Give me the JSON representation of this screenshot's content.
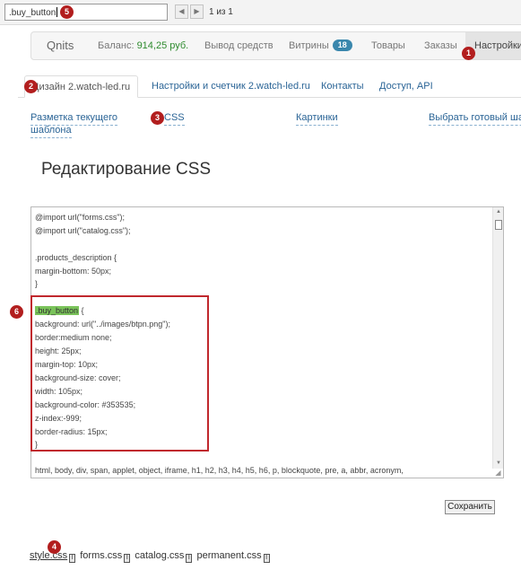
{
  "find_bar": {
    "query": ".buy_button",
    "prev_arrow": "◀",
    "next_arrow": "▶",
    "match_count": "1 из 1"
  },
  "markers": [
    "1",
    "2",
    "3",
    "4",
    "5",
    "6"
  ],
  "navbar": {
    "brand": "Qnits",
    "balance_label": "Баланс: ",
    "balance_value": "914,25 руб.",
    "withdraw": "Вывод средств",
    "showcases": "Витрины",
    "showcases_badge": "18",
    "goods": "Товары",
    "orders": "Заказы",
    "settings": "Настройки"
  },
  "tabs": [
    {
      "label": "Дизайн 2.watch-led.ru"
    },
    {
      "label": "Настройки и счетчик 2.watch-led.ru"
    },
    {
      "label": "Контакты"
    },
    {
      "label": "Доступ, API"
    }
  ],
  "subnav": {
    "markup_line1": "Разметка текущего",
    "markup_line2": "шаблона",
    "css": "CSS",
    "images": "Картинки",
    "choose_template": "Выбрать готовый шаблон"
  },
  "page_title": "Редактирование CSS",
  "editor": {
    "lines": [
      "@import url(\"forms.css\");",
      "@import url(\"catalog.css\");",
      "",
      ".products_description {",
      "    margin-bottom: 50px;",
      "}",
      "",
      ".buy_button {",
      "background: url(\"../images/btpn.png\");",
      "border:medium none;",
      "height: 25px;",
      "margin-top: 10px;",
      "background-size: cover;",
      "width: 105px;",
      "background-color: #353535;",
      "z-index:-999;",
      "border-radius: 15px;",
      "}",
      "",
      "html, body, div, span, applet, object, iframe, h1, h2, h3, h4, h5, h6, p, blockquote, pre, a, abbr, acronym,"
    ],
    "highlight_term": ".buy_button",
    "highlight_color": "#7ac35a"
  },
  "save_button": "Сохранить",
  "files": [
    "style.css",
    "forms.css",
    "catalog.css",
    "permanent.css"
  ],
  "file_icon_glyph": "I",
  "colors": {
    "marker": "#b21e1e",
    "link": "#2a6496",
    "badge": "#3a87ad",
    "balance": "#2e8b2e",
    "annotation_box": "#c0282d"
  }
}
